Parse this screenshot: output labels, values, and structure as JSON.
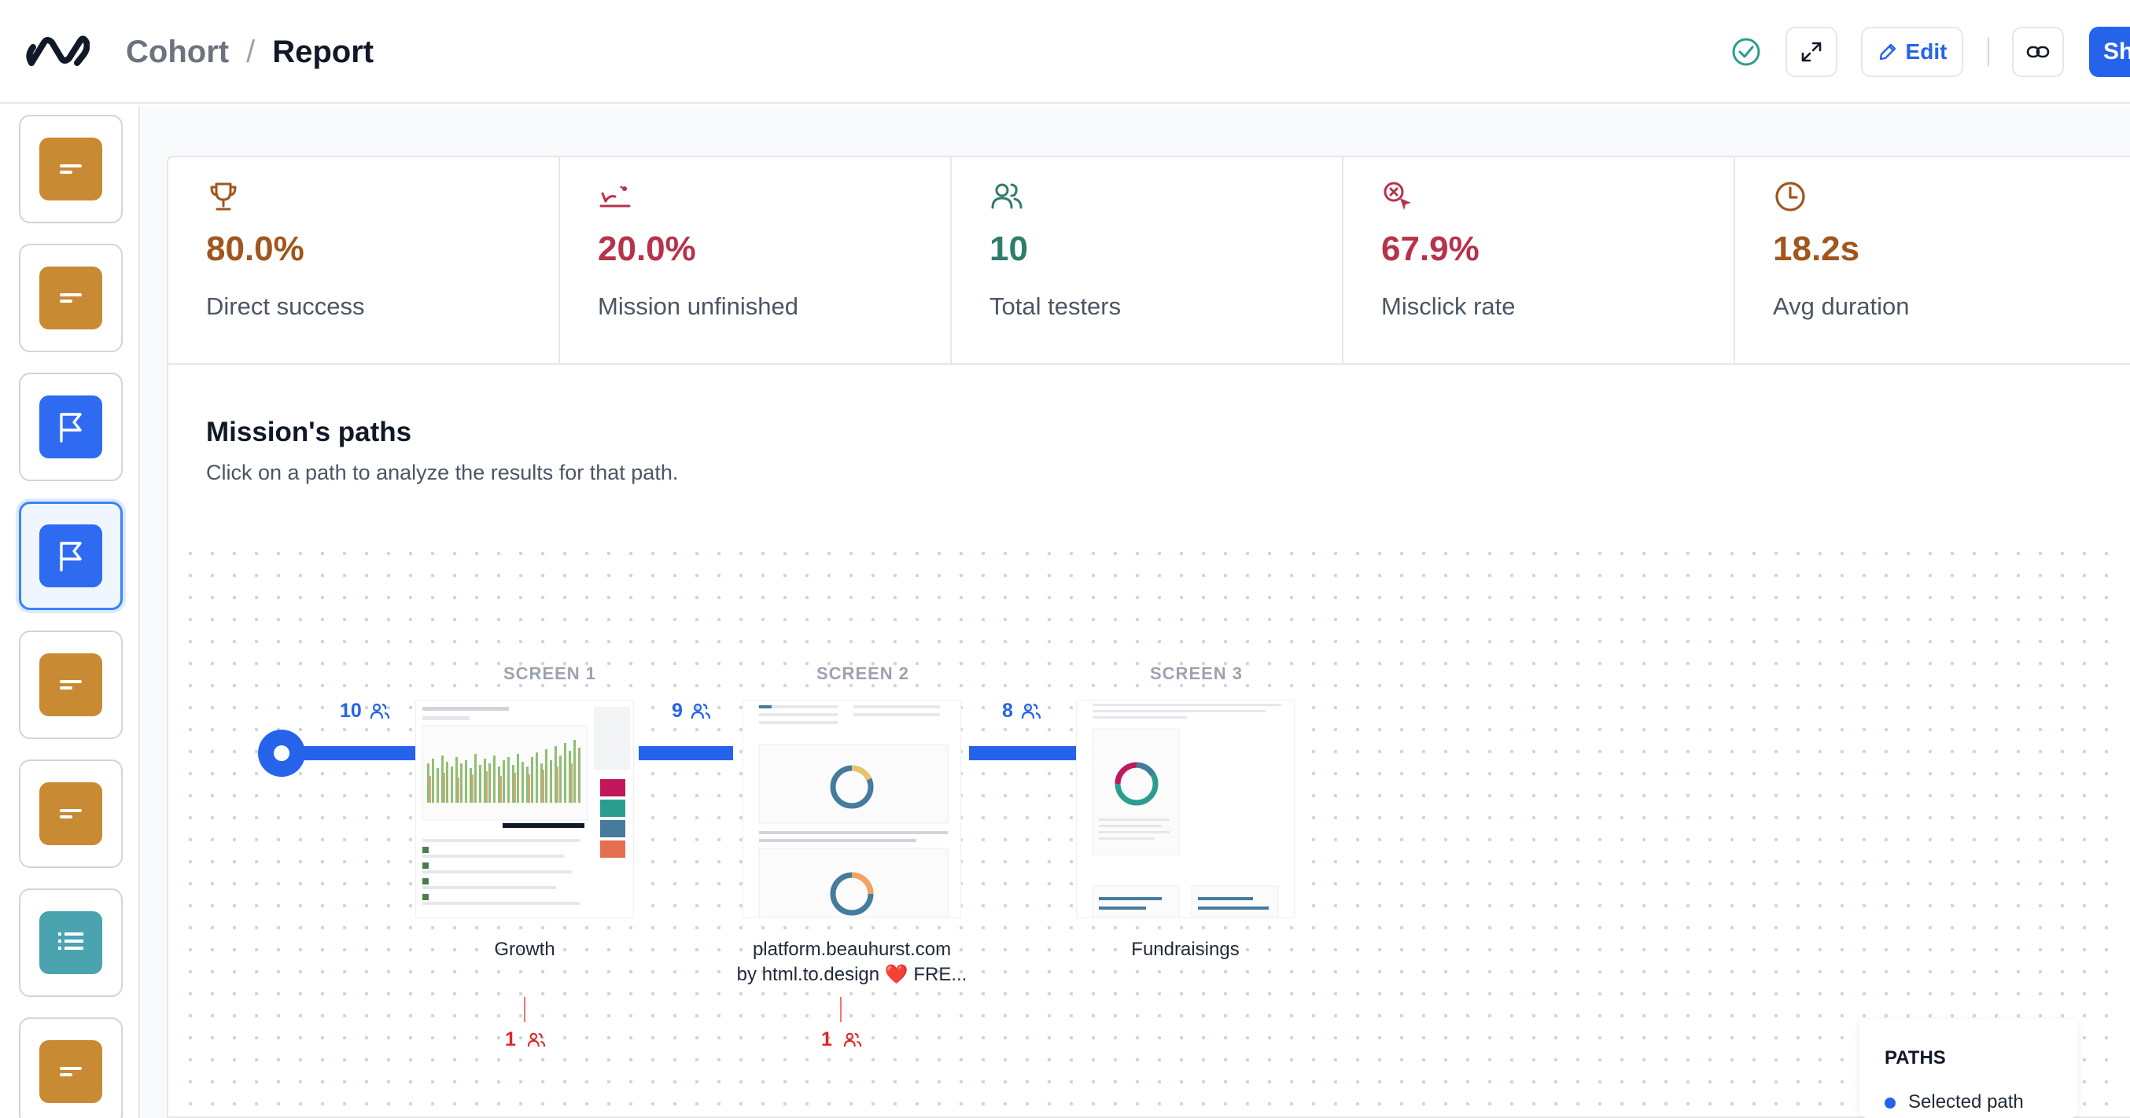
{
  "header": {
    "breadcrumb": [
      "Cohort",
      "Report"
    ],
    "separator": "/",
    "edit_label": "Edit",
    "share_label": "Sh",
    "accent": "#2563eb"
  },
  "sidebar": {
    "items": [
      {
        "icon": "text-block-icon",
        "color": "#c98a34",
        "active": false
      },
      {
        "icon": "text-block-icon",
        "color": "#c98a34",
        "active": false
      },
      {
        "icon": "flag-icon",
        "color": "#2f6bf0",
        "active": false
      },
      {
        "icon": "flag-icon",
        "color": "#2f6bf0",
        "active": true
      },
      {
        "icon": "text-block-icon",
        "color": "#c98a34",
        "active": false
      },
      {
        "icon": "text-block-icon",
        "color": "#c98a34",
        "active": false
      },
      {
        "icon": "list-icon",
        "color": "#4ba3b0",
        "active": false
      },
      {
        "icon": "text-block-icon",
        "color": "#c98a34",
        "active": false
      }
    ]
  },
  "stats": [
    {
      "value": "80.0%",
      "label": "Direct success",
      "icon": "trophy-icon",
      "color": "#a0561d"
    },
    {
      "value": "20.0%",
      "label": "Mission unfinished",
      "icon": "give-up-icon",
      "color": "#b8324a"
    },
    {
      "value": "10",
      "label": "Total testers",
      "icon": "users-icon",
      "color": "#2e7d6b"
    },
    {
      "value": "67.9%",
      "label": "Misclick rate",
      "icon": "misclick-icon",
      "color": "#b8324a"
    },
    {
      "value": "18.2s",
      "label": "Avg duration",
      "icon": "clock-icon",
      "color": "#a0561d"
    }
  ],
  "paths": {
    "title": "Mission's paths",
    "subtitle": "Click on a path to analyze the results for that path.",
    "screens": [
      {
        "label": "SCREEN 1",
        "name_lines": [
          "Growth"
        ]
      },
      {
        "label": "SCREEN 2",
        "name_lines": [
          "platform.beauhurst.com",
          "by html.to.design ❤️ FRE..."
        ]
      },
      {
        "label": "SCREEN 3",
        "name_lines": [
          "Fundraisings"
        ]
      }
    ],
    "counts": [
      "10",
      "9",
      "8"
    ],
    "dropoffs": [
      "1",
      "1"
    ]
  },
  "legend": {
    "title": "PATHS",
    "item": "Selected path"
  }
}
